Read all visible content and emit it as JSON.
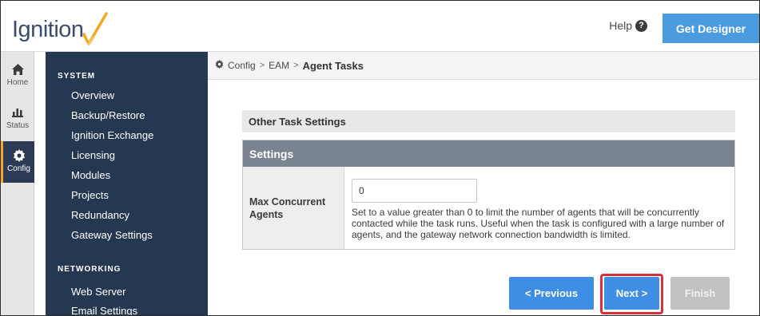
{
  "header": {
    "logo_text": "Ignition",
    "help_label": "Help",
    "help_icon": "question-circle-icon",
    "get_designer_label": "Get Designer",
    "accent_color": "#4a9be0"
  },
  "rail": {
    "items": [
      {
        "label": "Home",
        "icon": "home-icon"
      },
      {
        "label": "Status",
        "icon": "bar-chart-icon"
      },
      {
        "label": "Config",
        "icon": "gear-icon",
        "active": true
      }
    ]
  },
  "sidebar": {
    "sections": [
      {
        "title": "SYSTEM",
        "items": [
          "Overview",
          "Backup/Restore",
          "Ignition Exchange",
          "Licensing",
          "Modules",
          "Projects",
          "Redundancy",
          "Gateway Settings"
        ]
      },
      {
        "title": "NETWORKING",
        "items": [
          "Web Server",
          "Email Settings"
        ]
      }
    ]
  },
  "breadcrumb": {
    "icon": "gear-icon",
    "items": [
      "Config",
      "EAM"
    ],
    "current": "Agent Tasks",
    "separator": ">"
  },
  "main": {
    "section_title": "Other Task Settings",
    "settings_title": "Settings",
    "field": {
      "label": "Max Concurrent Agents",
      "value": "0",
      "help": "Set to a value greater than 0 to limit the number of agents that will be concurrently contacted while the task runs. Useful when the task is configured with a large number of agents, and the gateway network connection bandwidth is limited."
    }
  },
  "buttons": {
    "previous": "< Previous",
    "next": "Next >",
    "finish": "Finish",
    "highlight_color": "#d7313c"
  }
}
